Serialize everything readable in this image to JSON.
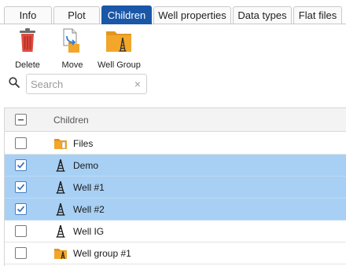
{
  "tabs": [
    {
      "label": "Info",
      "active": false
    },
    {
      "label": "Plot",
      "active": false
    },
    {
      "label": "Children",
      "active": true
    },
    {
      "label": "Well properties",
      "active": false
    },
    {
      "label": "Data types",
      "active": false
    },
    {
      "label": "Flat files",
      "active": false
    }
  ],
  "toolbar": {
    "delete_label": "Delete",
    "move_label": "Move",
    "well_group_label": "Well Group"
  },
  "search": {
    "placeholder": "Search",
    "value": "",
    "clear_glyph": "×"
  },
  "table": {
    "header": "Children",
    "header_checkbox_state": "indeterminate",
    "rows": [
      {
        "label": "Files",
        "icon": "folder-icon",
        "checked": false
      },
      {
        "label": "Demo",
        "icon": "well-derrick-icon",
        "checked": true
      },
      {
        "label": "Well #1",
        "icon": "well-derrick-icon",
        "checked": true
      },
      {
        "label": "Well #2",
        "icon": "well-derrick-icon",
        "checked": true
      },
      {
        "label": "Well IG",
        "icon": "well-derrick-icon",
        "checked": false
      },
      {
        "label": "Well group #1",
        "icon": "well-group-folder-icon",
        "checked": false
      }
    ]
  },
  "colors": {
    "active_tab": "#1a57a8",
    "selected_row": "#a8d0f5",
    "folder": "#f2a62a"
  }
}
